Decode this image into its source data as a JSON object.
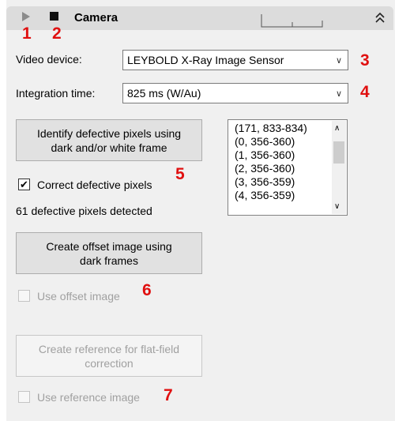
{
  "header": {
    "title": "Camera",
    "play_icon": "play-icon",
    "stop_icon": "stop-icon",
    "collapse_icon": "double-chevron-up-icon"
  },
  "annotations": [
    "1",
    "2",
    "3",
    "4",
    "5",
    "6",
    "7"
  ],
  "video_device": {
    "label": "Video device:",
    "value": "LEYBOLD X-Ray Image Sensor"
  },
  "integration_time": {
    "label": "Integration time:",
    "value": "825 ms (W/Au)"
  },
  "identify_button": {
    "line1": "Identify defective pixels using",
    "line2": "dark and/or white frame"
  },
  "correct_defective": {
    "label": "Correct defective pixels",
    "checked": true
  },
  "defective_count": "61 defective pixels detected",
  "defective_list": [
    "(171, 833-834)",
    "(0, 356-360)",
    "(1, 356-360)",
    "(2, 356-360)",
    "(3, 356-359)",
    "(4, 356-359)"
  ],
  "offset_button": {
    "line1": "Create offset image using",
    "line2": "dark frames"
  },
  "use_offset": {
    "label": "Use offset image",
    "checked": false,
    "enabled": false
  },
  "reference_button": {
    "line1": "Create reference for flat-field",
    "line2": "correction",
    "enabled": false
  },
  "use_reference": {
    "label": "Use reference image",
    "checked": false,
    "enabled": false
  },
  "colors": {
    "annotation": "#e01010",
    "header_bg": "#dcdcdc",
    "panel_bg": "#f0f0f0"
  }
}
